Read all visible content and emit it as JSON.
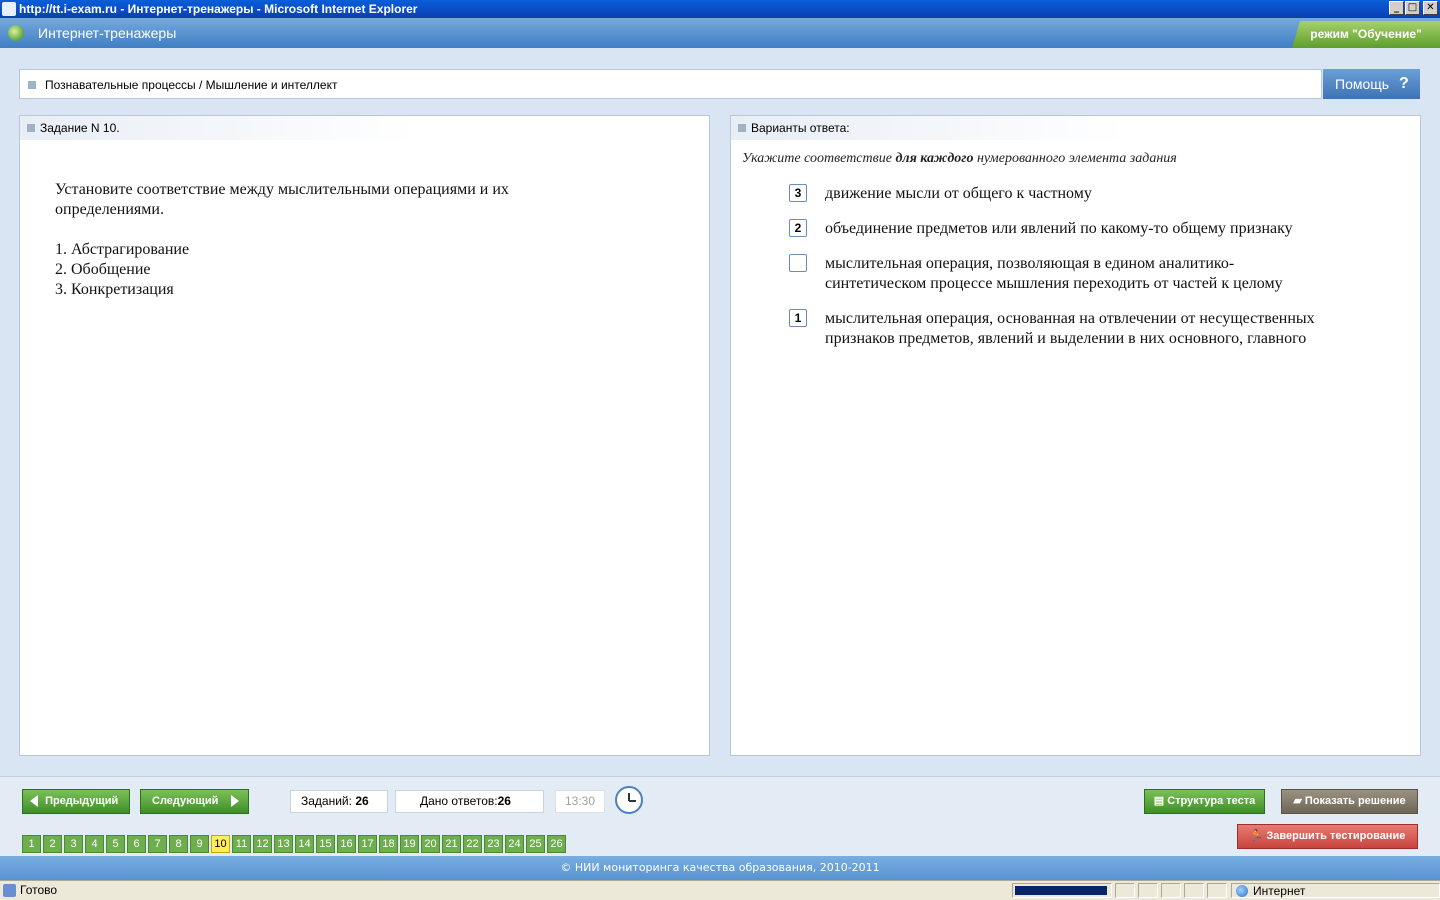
{
  "window": {
    "title": "http://tt.i-exam.ru - Интернет-тренажеры - Microsoft Internet Explorer",
    "minimize": "_",
    "maximize": "□",
    "close": "✕"
  },
  "app": {
    "title": "Интернет-тренажеры",
    "mode": "режим \"Обучение\""
  },
  "breadcrumb": {
    "text": "Познавательные процессы / Мышление и интеллект"
  },
  "help": {
    "label": "Помощь",
    "icon": "?"
  },
  "task": {
    "header": "Задание N 10.",
    "question": "Установите соответствие между мыслительными операциями и их определениями.",
    "items": [
      "1. Абстрагирование",
      "2. Обобщение",
      "3. Конкретизация"
    ]
  },
  "answers": {
    "header": "Варианты ответа:",
    "instruction_pre": "Укажите соответствие ",
    "instruction_bold": "для каждого",
    "instruction_post": " нумерованного элемента задания",
    "options": [
      {
        "value": "3",
        "text": "движение мысли от общего к частному"
      },
      {
        "value": "2",
        "text": "объединение предметов или явлений по какому-то общему признаку"
      },
      {
        "value": "",
        "text": "мыслительная операция, позволяющая в едином аналитико-синтетическом процессе мышления переходить от частей к целому"
      },
      {
        "value": "1",
        "text": "мыслительная операция, основанная на отвлечении от несущественных признаков предметов, явлений и выделении в них основного, главного"
      }
    ]
  },
  "footer": {
    "prev_label": "Предыдущий",
    "next_label": "Следующий",
    "tasks_label": "Заданий:",
    "tasks_count": "26",
    "answered_label": "Дано ответов:",
    "answered_count": "26",
    "timer": "13:30",
    "structure_label": "Структура теста",
    "show_solution_label": "Показать решение",
    "finish_label": "Завершить тестирование",
    "question_numbers": [
      "1",
      "2",
      "3",
      "4",
      "5",
      "6",
      "7",
      "8",
      "9",
      "10",
      "11",
      "12",
      "13",
      "14",
      "15",
      "16",
      "17",
      "18",
      "19",
      "20",
      "21",
      "22",
      "23",
      "24",
      "25",
      "26"
    ],
    "current_question": "10",
    "copyright": "© НИИ мониторинга качества образования, 2010-2011"
  },
  "statusbar": {
    "status": "Готово",
    "zone": "Интернет"
  },
  "colors": {
    "accent_blue": "#3d73b6",
    "green_button": "#5aa33a",
    "red_button": "#d9534f",
    "current_question": "#ffee58"
  }
}
